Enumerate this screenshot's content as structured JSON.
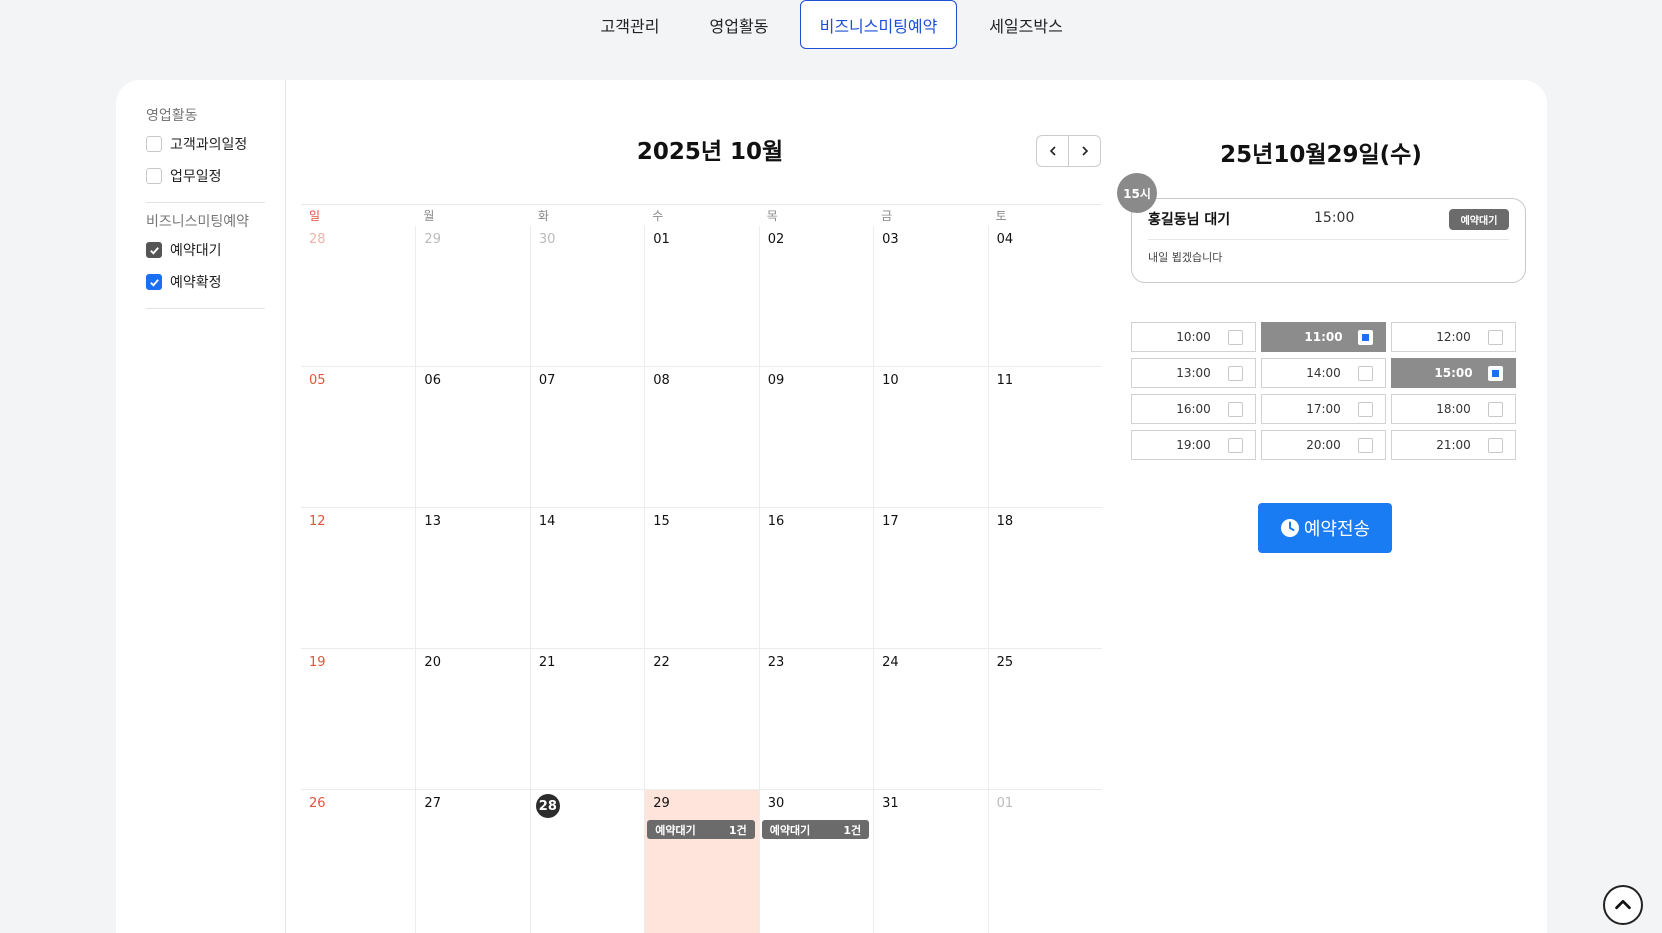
{
  "nav": {
    "tabs": [
      {
        "label": "고객관리"
      },
      {
        "label": "영업활동"
      },
      {
        "label": "비즈니스미팅예약"
      },
      {
        "label": "세일즈박스"
      }
    ]
  },
  "sidebar": {
    "group1": {
      "title": "영업활동",
      "items": [
        {
          "label": "고객과의일정",
          "checked": false
        },
        {
          "label": "업무일정",
          "checked": false
        }
      ]
    },
    "group2": {
      "title": "비즈니스미팅예약",
      "items": [
        {
          "label": "예약대기",
          "checked": true
        },
        {
          "label": "예약확정",
          "checked": true
        }
      ]
    }
  },
  "calendar": {
    "title": "2025년 10월",
    "prev_icon": "chevron-left-icon",
    "next_icon": "chevron-right-icon",
    "weekdays": [
      "일",
      "월",
      "화",
      "수",
      "목",
      "금",
      "토"
    ],
    "weeks": [
      [
        "28",
        "29",
        "30",
        "01",
        "02",
        "03",
        "04"
      ],
      [
        "05",
        "06",
        "07",
        "08",
        "09",
        "10",
        "11"
      ],
      [
        "12",
        "13",
        "14",
        "15",
        "16",
        "17",
        "18"
      ],
      [
        "19",
        "20",
        "21",
        "22",
        "23",
        "24",
        "25"
      ],
      [
        "26",
        "27",
        "28",
        "29",
        "30",
        "31",
        "01"
      ]
    ],
    "events": [
      {
        "label": "예약대기",
        "count": "1건"
      },
      {
        "label": "예약대기",
        "count": "1건"
      }
    ]
  },
  "detail": {
    "title": "25년10월29일(수)",
    "hour_badge": "15시",
    "appointment": {
      "name": "홍길동님 대기",
      "time": "15:00",
      "status": "예약대기",
      "memo": "내일 뵙겠습니다"
    },
    "slots": [
      {
        "time": "10:00",
        "selected": false
      },
      {
        "time": "11:00",
        "selected": true
      },
      {
        "time": "12:00",
        "selected": false
      },
      {
        "time": "13:00",
        "selected": false
      },
      {
        "time": "14:00",
        "selected": false
      },
      {
        "time": "15:00",
        "selected": true
      },
      {
        "time": "16:00",
        "selected": false
      },
      {
        "time": "17:00",
        "selected": false
      },
      {
        "time": "18:00",
        "selected": false
      },
      {
        "time": "19:00",
        "selected": false
      },
      {
        "time": "20:00",
        "selected": false
      },
      {
        "time": "21:00",
        "selected": false
      }
    ],
    "send_button": "예약전송",
    "send_icon": "clock-icon"
  },
  "scroll_top_icon": "chevron-up-icon",
  "colors": {
    "accent": "#1a7cf2",
    "nav_active": "#1d4fd8",
    "sunday": "#e5533d",
    "selected_day_bg": "#ffe4dc",
    "event_bg": "#6b6b6b"
  }
}
